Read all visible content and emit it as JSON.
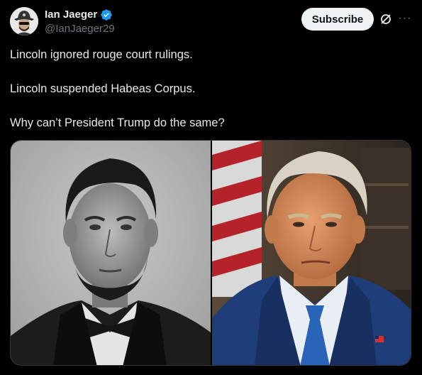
{
  "author": {
    "display_name": "Ian Jaeger",
    "handle": "@IanJaeger29",
    "verified_icon": "verified-badge-icon",
    "avatar_icon": "avatar-hat-icon"
  },
  "actions": {
    "subscribe_label": "Subscribe",
    "grok_icon": "grok-slash-icon",
    "more_icon": "more-dots-icon",
    "more_glyph": "···"
  },
  "tweet": {
    "lines": [
      "Lincoln ignored rouge court rulings.",
      "Lincoln suspended Habeas Corpus.",
      "Why can’t President Trump do the same?"
    ]
  },
  "media": {
    "images": [
      "lincoln-portrait-photo",
      "trump-portrait-photo"
    ]
  },
  "colors": {
    "background": "#000000",
    "text": "#e7e9ea",
    "muted": "#71767b",
    "verified": "#1d9bf0",
    "button_bg": "#eff3f4",
    "button_text": "#0f1419"
  }
}
